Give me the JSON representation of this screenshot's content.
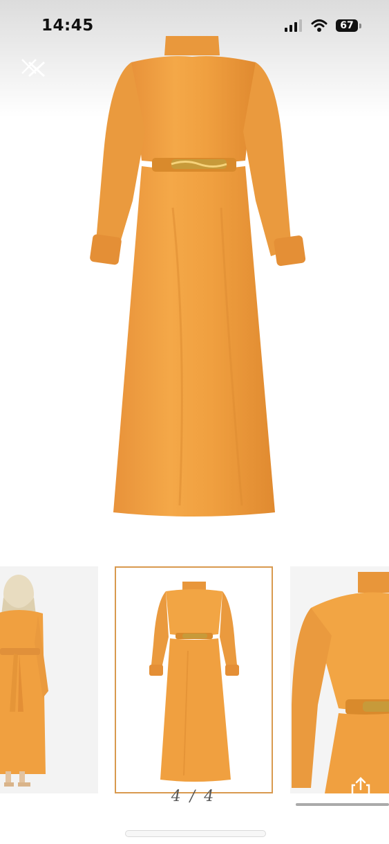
{
  "status_bar": {
    "time": "14:45",
    "battery": "67"
  },
  "viewer": {
    "counter": "4 / 4",
    "current_index": 4,
    "total": 4
  },
  "icons": {
    "close": "close-icon",
    "share": "share-icon",
    "signal": "cellular-signal-icon",
    "wifi": "wifi-icon",
    "battery": "battery-icon"
  },
  "colors": {
    "dress": "#f0a040",
    "dress_shadow": "#d98a2c",
    "belt_gold": "#c79a3a",
    "selected_border": "#d8994e"
  }
}
